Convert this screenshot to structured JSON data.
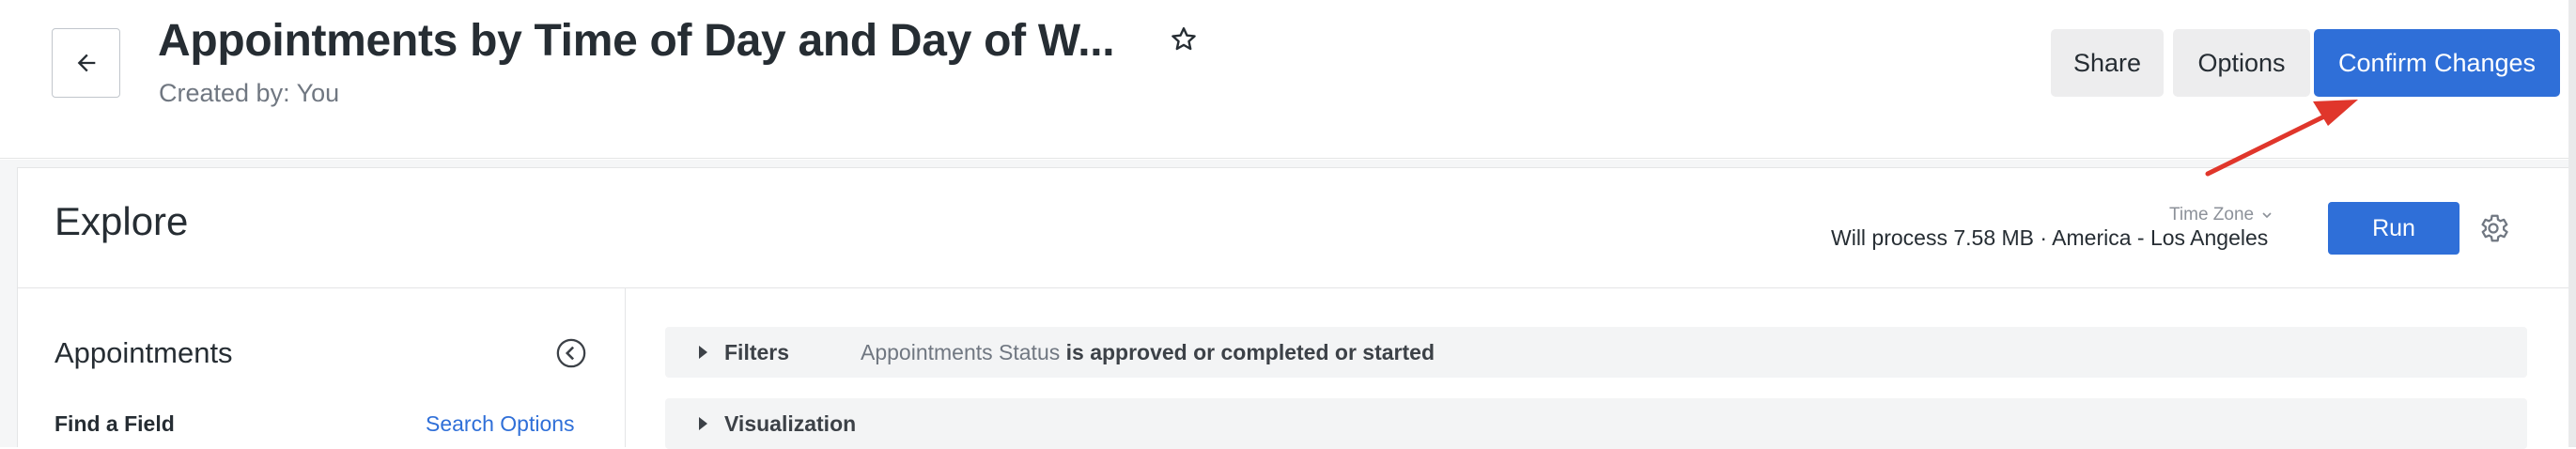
{
  "header": {
    "title": "Appointments by Time of Day and Day of W...",
    "created_by": "Created by: You",
    "share_label": "Share",
    "options_label": "Options",
    "confirm_label": "Confirm Changes"
  },
  "explore": {
    "title": "Explore",
    "timezone_label": "Time Zone",
    "process_info": "Will process 7.58 MB · America - Los Angeles",
    "run_label": "Run"
  },
  "sidebar": {
    "title": "Appointments",
    "find_field_label": "Find a Field",
    "search_options_label": "Search Options"
  },
  "sections": {
    "filters_label": "Filters",
    "filter_field": "Appointments Status",
    "filter_condition": "is approved or completed or started",
    "visualization_label": "Visualization"
  },
  "icons": {
    "back": "arrow-left-icon",
    "favorite": "star-outline-icon",
    "timezone_toggle": "chevron-down-icon",
    "settings": "gear-icon",
    "collapse": "chevron-left-circle-icon",
    "expand": "caret-right-icon"
  },
  "colors": {
    "accent": "#2f6fd8",
    "annotation_arrow": "#e0362b",
    "secondary_button": "#ededee",
    "section_bar": "#f3f4f5"
  }
}
